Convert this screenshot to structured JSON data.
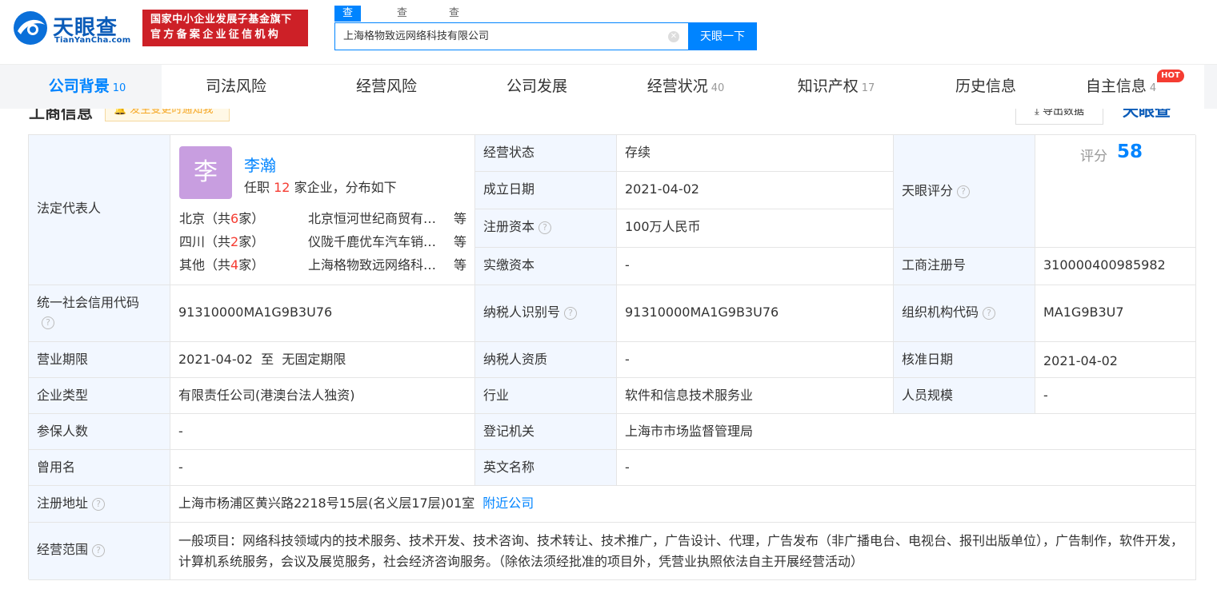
{
  "header": {
    "logo_text": "天眼查",
    "logo_sub": "TianYanCha.com",
    "badge_line1": "国家中小企业发展子基金旗下",
    "badge_line2": "官方备案企业征信机构",
    "search_tabs": [
      "查公司",
      "查老板",
      "查关系"
    ],
    "search_value": "上海格物致远网络科技有限公司",
    "search_button": "天眼一下"
  },
  "nav": {
    "tabs": [
      {
        "label": "公司背景",
        "count": "10"
      },
      {
        "label": "司法风险",
        "count": ""
      },
      {
        "label": "经营风险",
        "count": ""
      },
      {
        "label": "公司发展",
        "count": ""
      },
      {
        "label": "经营状况",
        "count": "40"
      },
      {
        "label": "知识产权",
        "count": "17"
      },
      {
        "label": "历史信息",
        "count": ""
      },
      {
        "label": "自主信息",
        "count": "4"
      }
    ],
    "hot_badge": "HOT"
  },
  "section": {
    "title": "工商信息",
    "notify": "发生变更时通知我",
    "export": "导出数据",
    "brand": "天眼查"
  },
  "legal": {
    "label": "法定代表人",
    "avatar_char": "李",
    "name": "李瀚",
    "desc_prefix": "任职",
    "desc_count": "12",
    "desc_suffix": "家企业，分布如下",
    "distribution": [
      {
        "region": "北京",
        "count": "6",
        "company": "北京恒河世纪商贸有限公司",
        "etc": "等"
      },
      {
        "region": "四川",
        "count": "2",
        "company": "仪陇千鹿优车汽车销售有限公司",
        "etc": "等"
      },
      {
        "region": "其他",
        "count": "4",
        "company": "上海格物致远网络科技有限公司",
        "etc": "等"
      }
    ],
    "region_open": "（共",
    "region_close": "家）"
  },
  "info": {
    "status_label": "经营状态",
    "status": "存续",
    "founded_label": "成立日期",
    "founded": "2021-04-02",
    "capital_label": "注册资本",
    "capital": "100万人民币",
    "paid_label": "实缴资本",
    "paid": "-",
    "score_label": "天眼评分",
    "score_text": "评分",
    "score": "58",
    "reg_no_label": "工商注册号",
    "reg_no": "310000400985982",
    "credit_label": "统一社会信用代码",
    "credit": "91310000MA1G9B3U76",
    "tax_id_label": "纳税人识别号",
    "tax_id": "91310000MA1G9B3U76",
    "org_label": "组织机构代码",
    "org": "MA1G9B3U7",
    "term_label": "营业期限",
    "term": "2021-04-02  至  无固定期限",
    "tax_qual_label": "纳税人资质",
    "tax_qual": "-",
    "approve_label": "核准日期",
    "approve": "2021-04-02",
    "type_label": "企业类型",
    "type": "有限责任公司(港澳台法人独资)",
    "industry_label": "行业",
    "industry": "软件和信息技术服务业",
    "staff_label": "人员规模",
    "staff": "-",
    "insured_label": "参保人数",
    "insured": "-",
    "authority_label": "登记机关",
    "authority": "上海市市场监督管理局",
    "former_label": "曾用名",
    "former": "-",
    "english_label": "英文名称",
    "english": "-",
    "address_label": "注册地址",
    "address": "上海市杨浦区黄兴路2218号15层(名义层17层)01室",
    "nearby": "附近公司",
    "scope_label": "经营范围",
    "scope": "一般项目：网络科技领域内的技术服务、技术开发、技术咨询、技术转让、技术推广，广告设计、代理，广告发布（非广播电台、电视台、报刊出版单位），广告制作，软件开发，计算机系统服务，会议及展览服务，社会经济咨询服务。（除依法须经批准的项目外，凭营业执照依法自主开展经营活动）"
  },
  "colors": {
    "accent": "#0084ff",
    "badge_red": "#cd2027",
    "label_bg": "#f2f7ff",
    "highlight": "#f53c32"
  }
}
